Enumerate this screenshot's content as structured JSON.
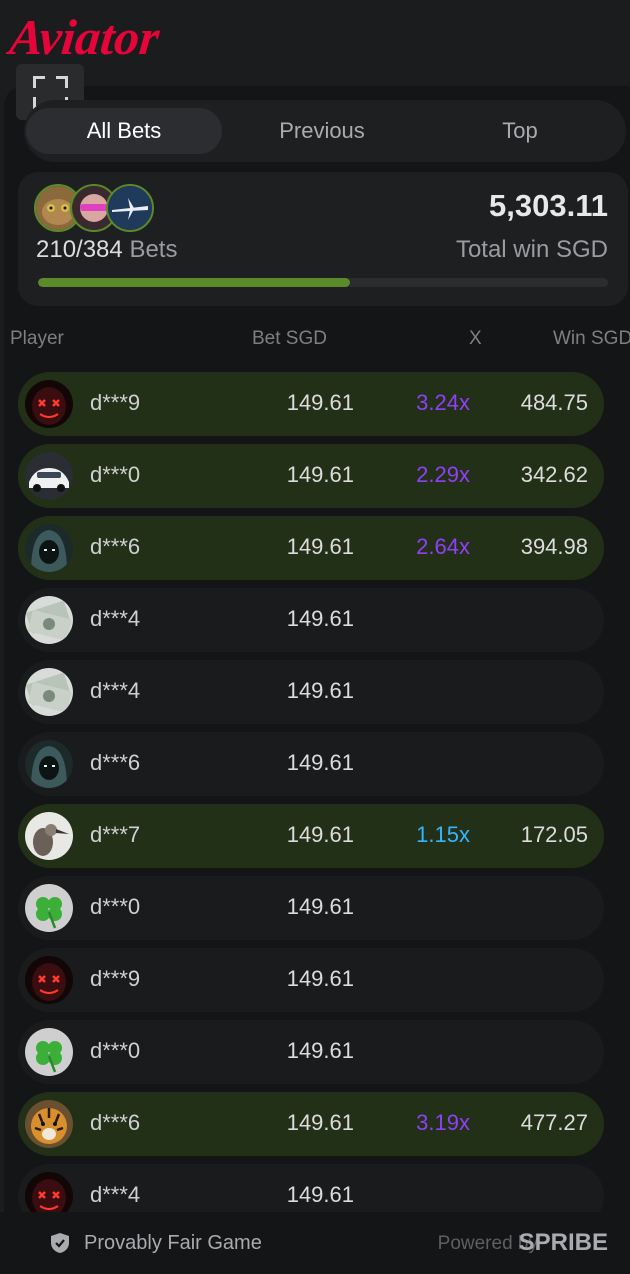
{
  "app": {
    "logo_text": "Aviator"
  },
  "tabs": [
    {
      "label": "All Bets",
      "active": true
    },
    {
      "label": "Previous",
      "active": false
    },
    {
      "label": "Top",
      "active": false
    }
  ],
  "summary": {
    "bets_count": "210/384",
    "bets_label": "Bets",
    "total_value": "5,303.11",
    "total_label": "Total win SGD",
    "progress_fraction": 0.547
  },
  "columns": {
    "player": "Player",
    "bet": "Bet SGD",
    "mult": "X",
    "win": "Win SGD"
  },
  "rows": [
    {
      "player": "d***9",
      "bet": "149.61",
      "mult": "3.24x",
      "win": "484.75",
      "won": true,
      "mult_color": "#913ef8",
      "avatar": "mask-icon"
    },
    {
      "player": "d***0",
      "bet": "149.61",
      "mult": "2.29x",
      "win": "342.62",
      "won": true,
      "mult_color": "#913ef8",
      "avatar": "car-icon"
    },
    {
      "player": "d***6",
      "bet": "149.61",
      "mult": "2.64x",
      "win": "394.98",
      "won": true,
      "mult_color": "#913ef8",
      "avatar": "hood-icon"
    },
    {
      "player": "d***4",
      "bet": "149.61",
      "mult": "",
      "win": "",
      "won": false,
      "avatar": "money-icon"
    },
    {
      "player": "d***4",
      "bet": "149.61",
      "mult": "",
      "win": "",
      "won": false,
      "avatar": "money-icon"
    },
    {
      "player": "d***6",
      "bet": "149.61",
      "mult": "",
      "win": "",
      "won": false,
      "avatar": "hood-icon"
    },
    {
      "player": "d***7",
      "bet": "149.61",
      "mult": "1.15x",
      "win": "172.05",
      "won": true,
      "mult_color": "#34b4ff",
      "avatar": "bird-icon"
    },
    {
      "player": "d***0",
      "bet": "149.61",
      "mult": "",
      "win": "",
      "won": false,
      "avatar": "clover-icon"
    },
    {
      "player": "d***9",
      "bet": "149.61",
      "mult": "",
      "win": "",
      "won": false,
      "avatar": "mask-icon"
    },
    {
      "player": "d***0",
      "bet": "149.61",
      "mult": "",
      "win": "",
      "won": false,
      "avatar": "clover-icon"
    },
    {
      "player": "d***6",
      "bet": "149.61",
      "mult": "3.19x",
      "win": "477.27",
      "won": true,
      "mult_color": "#913ef8",
      "avatar": "tiger-icon"
    },
    {
      "player": "d***4",
      "bet": "149.61",
      "mult": "",
      "win": "",
      "won": false,
      "avatar": "mask-icon"
    }
  ],
  "footer": {
    "fair_label": "Provably Fair Game",
    "powered_label": "Powered by",
    "brand": "SPRIBE"
  },
  "colors": {
    "accent_red": "#e50539",
    "win_row": "#233018",
    "progress": "#5b8a2a"
  }
}
